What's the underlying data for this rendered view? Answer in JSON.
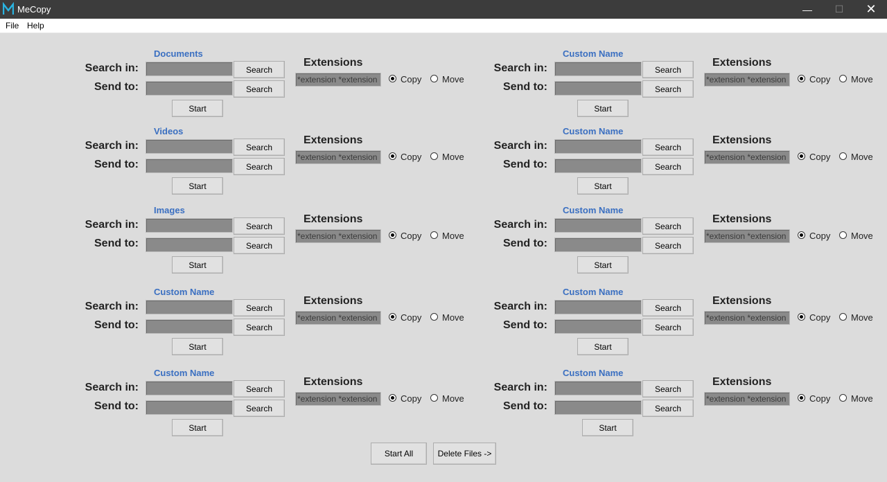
{
  "window": {
    "title": "MeCopy",
    "minimize_glyph": "—",
    "maximize_glyph": "☐",
    "close_glyph": "✕",
    "logo_color": "#2ab3e0"
  },
  "menu": [
    "File",
    "Help"
  ],
  "labels": {
    "search_in": "Search in:",
    "send_to": "Send to:",
    "search_button": "Search",
    "start_button": "Start",
    "extensions_title": "Extensions",
    "extensions_placeholder": "*extension *extension",
    "copy": "Copy",
    "move": "Move"
  },
  "blocks": [
    {
      "heading": "Documents",
      "mode": "copy"
    },
    {
      "heading": "Custom Name",
      "mode": "copy"
    },
    {
      "heading": "Videos",
      "mode": "copy"
    },
    {
      "heading": "Custom Name",
      "mode": "copy"
    },
    {
      "heading": "Images",
      "mode": "copy"
    },
    {
      "heading": "Custom Name",
      "mode": "copy"
    },
    {
      "heading": "Custom Name",
      "mode": "copy"
    },
    {
      "heading": "Custom Name",
      "mode": "copy"
    },
    {
      "heading": "Custom Name",
      "mode": "copy"
    },
    {
      "heading": "Custom Name",
      "mode": "copy"
    }
  ],
  "footer": {
    "start_all": "Start All",
    "delete_files": "Delete Files ->"
  },
  "colors": {
    "background": "#dcdcdc",
    "heading": "#3a6fc1",
    "field": "#8a8a8a",
    "titlebar": "#3c3c3c"
  }
}
